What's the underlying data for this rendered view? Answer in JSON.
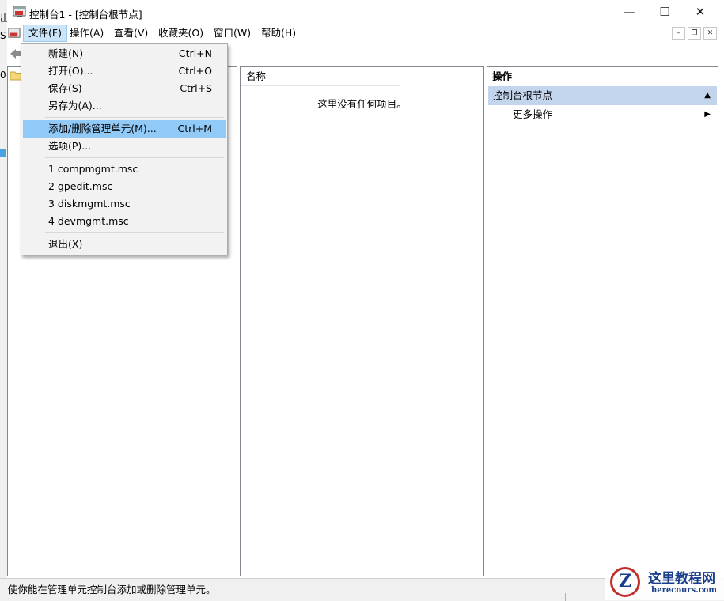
{
  "window": {
    "title": "控制台1 - [控制台根节点]",
    "minimize_glyph": "—",
    "maximize_glyph": "☐",
    "close_glyph": "✕"
  },
  "background_window": {
    "line1": "出",
    "line2": "S",
    "line3": "0"
  },
  "menubar": {
    "items": [
      "文件(F)",
      "操作(A)",
      "查看(V)",
      "收藏夹(O)",
      "窗口(W)",
      "帮助(H)"
    ],
    "active_index": 0,
    "mdi_minimize": "–",
    "mdi_restore": "❐",
    "mdi_close": "✕"
  },
  "file_menu": {
    "items": [
      {
        "label": "新建(N)",
        "shortcut": "Ctrl+N"
      },
      {
        "label": "打开(O)...",
        "shortcut": "Ctrl+O"
      },
      {
        "label": "保存(S)",
        "shortcut": "Ctrl+S"
      },
      {
        "label": "另存为(A)...",
        "shortcut": ""
      },
      {
        "label": "添加/删除管理单元(M)...",
        "shortcut": "Ctrl+M",
        "highlighted": true
      },
      {
        "label": "选项(P)...",
        "shortcut": ""
      },
      {
        "label": "1 compmgmt.msc",
        "shortcut": ""
      },
      {
        "label": "2 gpedit.msc",
        "shortcut": ""
      },
      {
        "label": "3 diskmgmt.msc",
        "shortcut": ""
      },
      {
        "label": "4 devmgmt.msc",
        "shortcut": ""
      },
      {
        "label": "退出(X)",
        "shortcut": ""
      }
    ]
  },
  "middle_pane": {
    "column_header": "名称",
    "empty_message": "这里没有任何项目。"
  },
  "actions_pane": {
    "header": "操作",
    "section": "控制台根节点",
    "more_actions": "更多操作"
  },
  "statusbar": {
    "text": "使你能在管理单元控制台添加或删除管理单元。"
  },
  "watermark": {
    "cn": "这里教程网",
    "en": "herecours.com",
    "logo_letter": "Z"
  },
  "colors": {
    "highlight": "#91c9f7",
    "section_bg": "#c2d5ec",
    "menu_active": "#cce4f7"
  }
}
